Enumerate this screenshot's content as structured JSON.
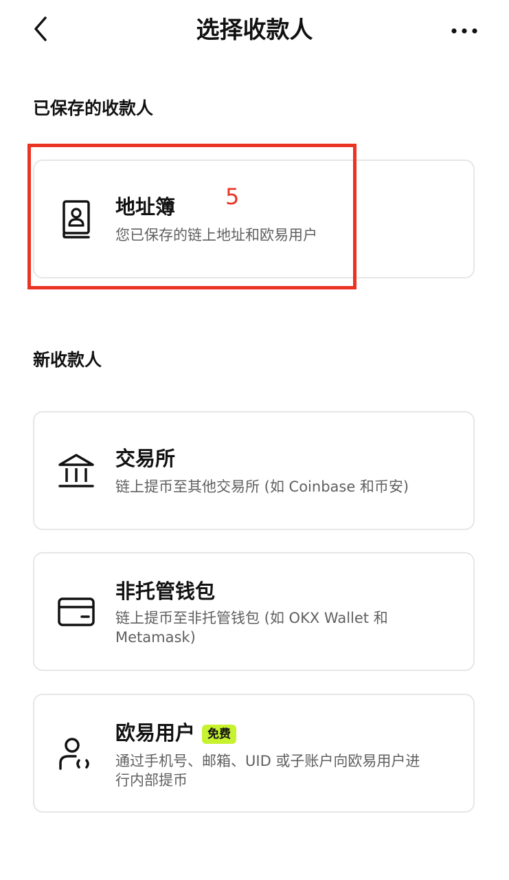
{
  "header": {
    "title": "选择收款人",
    "back_icon": "chevron-left-icon",
    "more_icon": "more-horizontal-icon"
  },
  "saved_section": {
    "title": "已保存的收款人",
    "items": [
      {
        "title": "地址簿",
        "description": "您已保存的链上地址和欧易用户",
        "icon": "address-book-icon"
      }
    ]
  },
  "new_section": {
    "title": "新收款人",
    "items": [
      {
        "title": "交易所",
        "description": "链上提币至其他交易所 (如 Coinbase 和币安)",
        "icon": "bank-building-icon"
      },
      {
        "title": "非托管钱包",
        "description": "链上提币至非托管钱包 (如 OKX Wallet 和 Metamask)",
        "icon": "wallet-icon"
      },
      {
        "title": "欧易用户",
        "badge": "免费",
        "description": "通过手机号、邮箱、UID 或子账户向欧易用户进行内部提币",
        "icon": "user-link-icon"
      }
    ]
  },
  "annotation": {
    "label": "5",
    "color": "#ea3323"
  },
  "colors": {
    "badge_bg": "#c6f22f",
    "card_border": "#e6e6e6",
    "secondary_text": "#5f5f5f"
  }
}
